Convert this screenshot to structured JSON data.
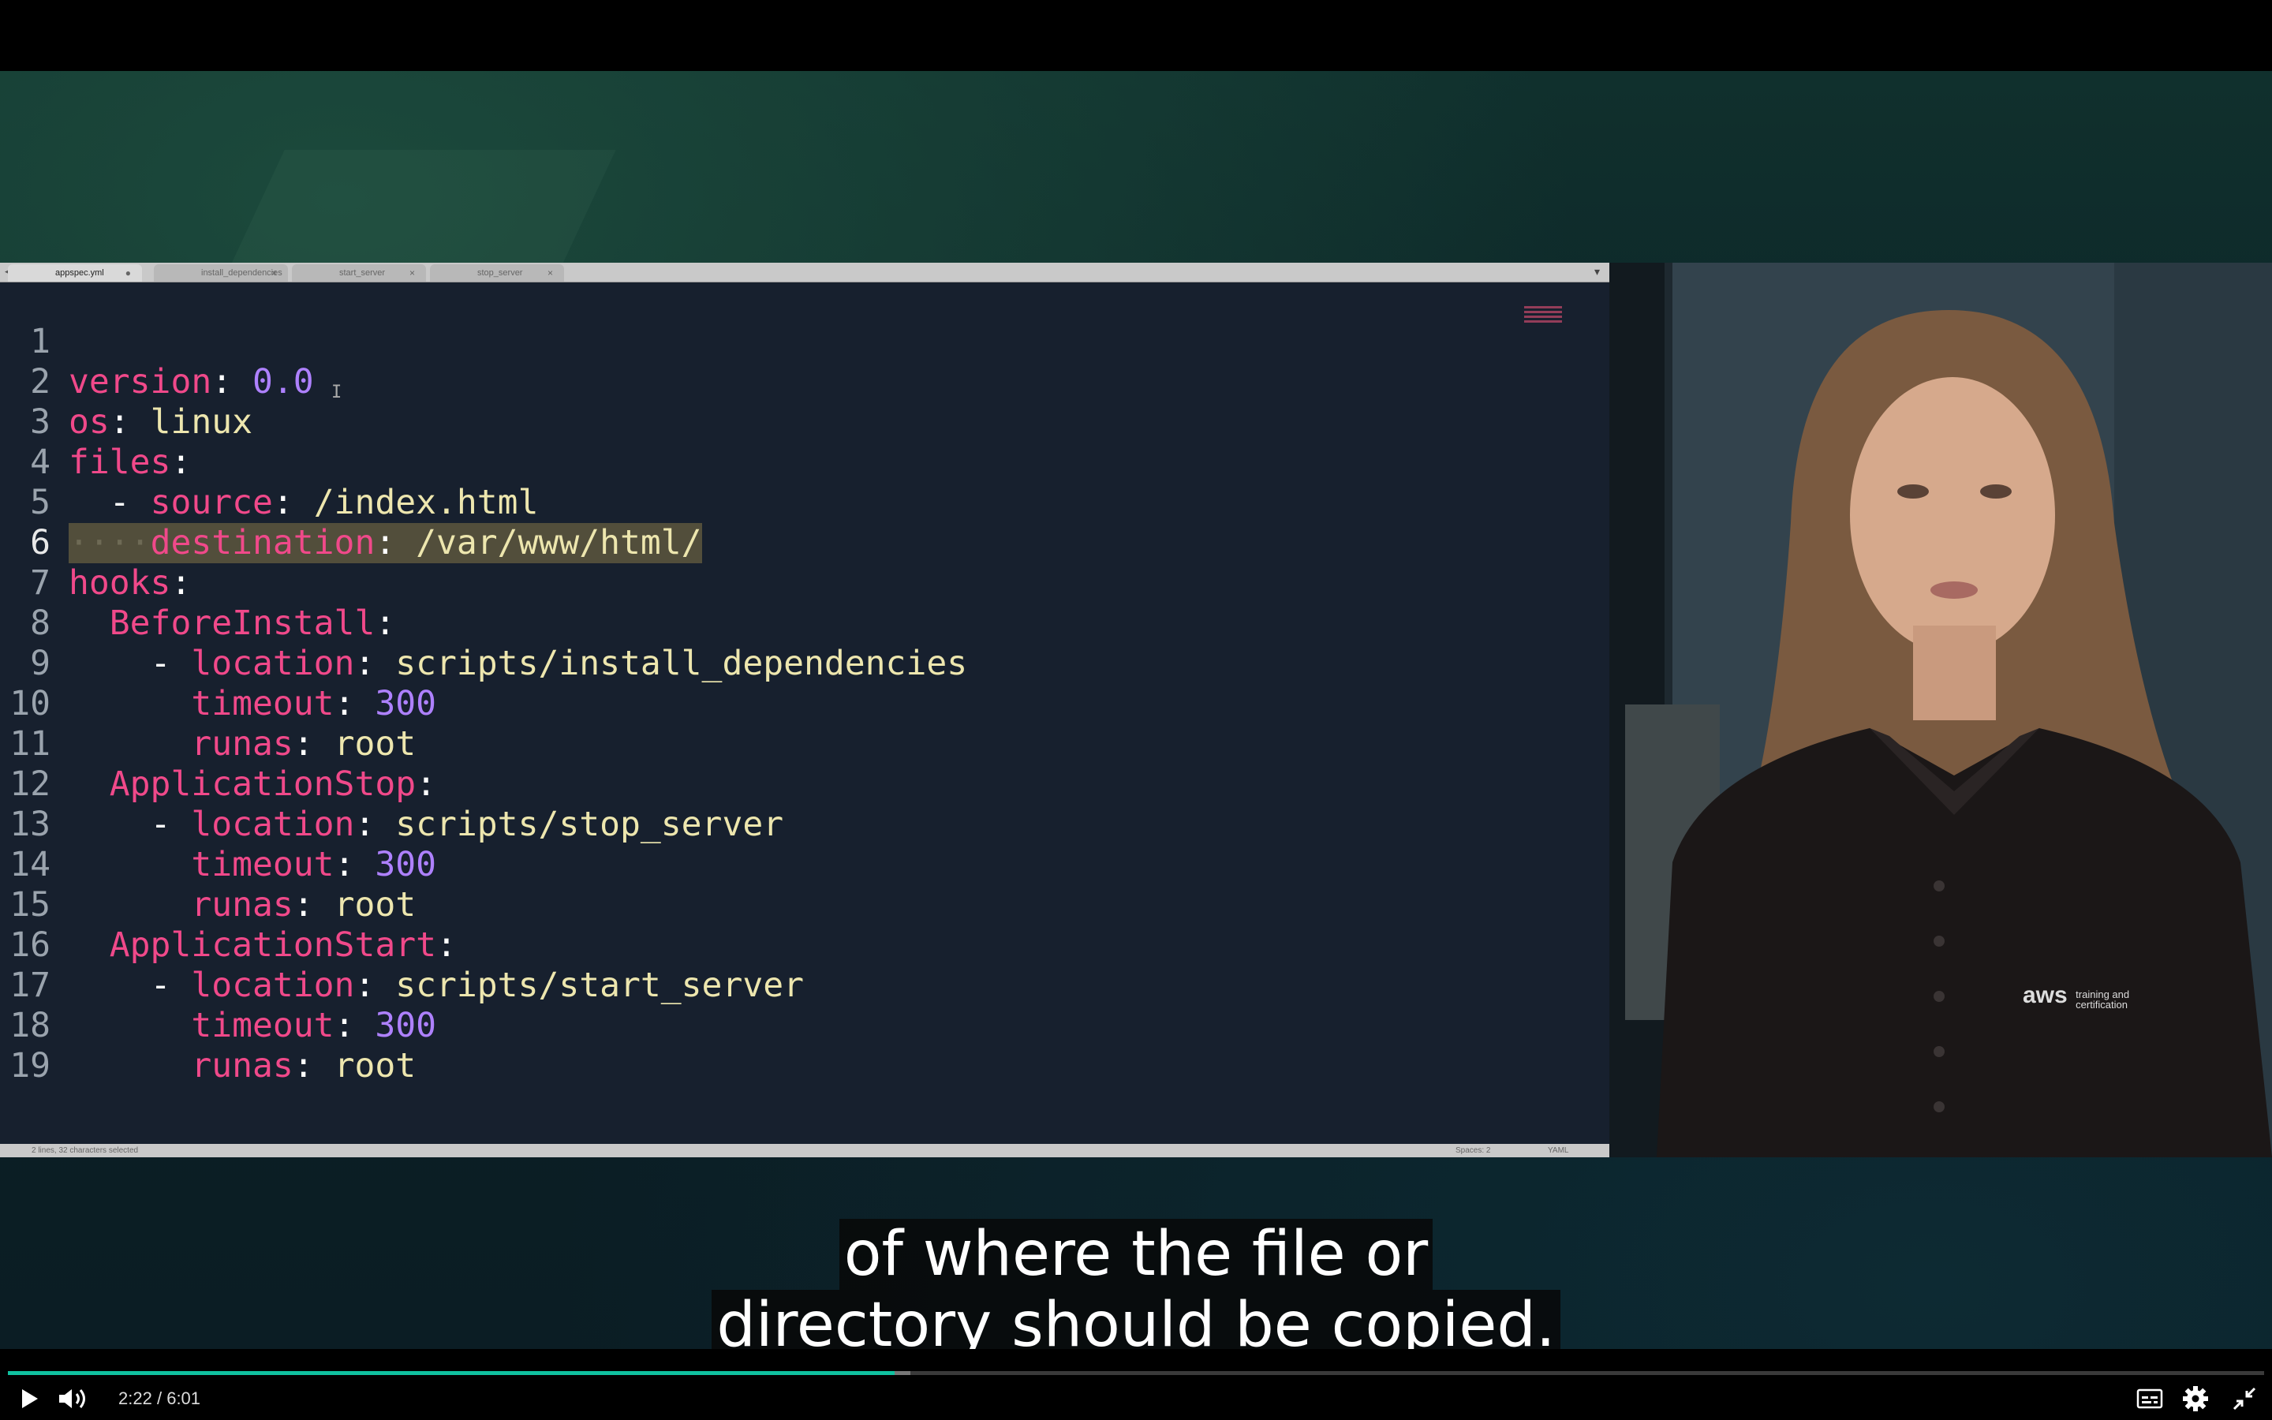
{
  "editor": {
    "tabs": [
      {
        "label": "appspec.yml",
        "modified": "●",
        "active": true
      },
      {
        "label": "install_dependencies",
        "close": "×",
        "active": false
      },
      {
        "label": "start_server",
        "close": "×",
        "active": false
      },
      {
        "label": "stop_server",
        "close": "×",
        "active": false
      }
    ],
    "nav_arrows": "◂ ▸",
    "tab_menu": "▾",
    "lines": [
      {
        "num": "1"
      },
      {
        "num": "2"
      },
      {
        "num": "3"
      },
      {
        "num": "4"
      },
      {
        "num": "5"
      },
      {
        "num": "6"
      },
      {
        "num": "7"
      },
      {
        "num": "8"
      },
      {
        "num": "9"
      },
      {
        "num": "10"
      },
      {
        "num": "11"
      },
      {
        "num": "12"
      },
      {
        "num": "13"
      },
      {
        "num": "14"
      },
      {
        "num": "15"
      },
      {
        "num": "16"
      },
      {
        "num": "17"
      },
      {
        "num": "18"
      },
      {
        "num": "19"
      }
    ],
    "code": {
      "l1_key": "version",
      "l1_val": "0.0",
      "l2_key": "os",
      "l2_val": "linux",
      "l3_key": "files",
      "l4_dash": "- ",
      "l4_key": "source",
      "l4_val": "/index.html",
      "l5_dots": "····",
      "l5_key": "destination",
      "l5_val": "/var/www/html/",
      "l6_key": "hooks",
      "l7_key": "BeforeInstall",
      "l8_dash": "- ",
      "l8_key": "location",
      "l8_val": "scripts/install_dependencies",
      "l9_key": "timeout",
      "l9_val": "300",
      "l10_key": "runas",
      "l10_val": "root",
      "l11_key": "ApplicationStop",
      "l12_dash": "- ",
      "l12_key": "location",
      "l12_val": "scripts/stop_server",
      "l13_key": "timeout",
      "l13_val": "300",
      "l14_key": "runas",
      "l14_val": "root",
      "l15_key": "ApplicationStart",
      "l16_dash": "- ",
      "l16_key": "location",
      "l16_val": "scripts/start_server",
      "l17_key": "timeout",
      "l17_val": "300",
      "l18_key": "runas",
      "l18_val": "root",
      "colon": ":"
    },
    "current_line": 6,
    "status": {
      "selection": "2 lines, 32 characters selected",
      "spaces": "Spaces: 2",
      "syntax": "YAML"
    }
  },
  "presenter": {
    "logo_text": "aws",
    "logo_tagline_1": "training and",
    "logo_tagline_2": "certification"
  },
  "captions": {
    "line1": "of where the file or",
    "line2": "directory should be copied."
  },
  "player": {
    "current_time": "2:22",
    "separator": "/",
    "duration": "6:01",
    "progress_fraction": 0.393,
    "buffered_fraction": 0.4,
    "progress_color": "#10c2a0",
    "icons": [
      "play-icon",
      "volume-icon",
      "captions-icon",
      "settings-gear-icon",
      "exit-fullscreen-icon"
    ]
  }
}
